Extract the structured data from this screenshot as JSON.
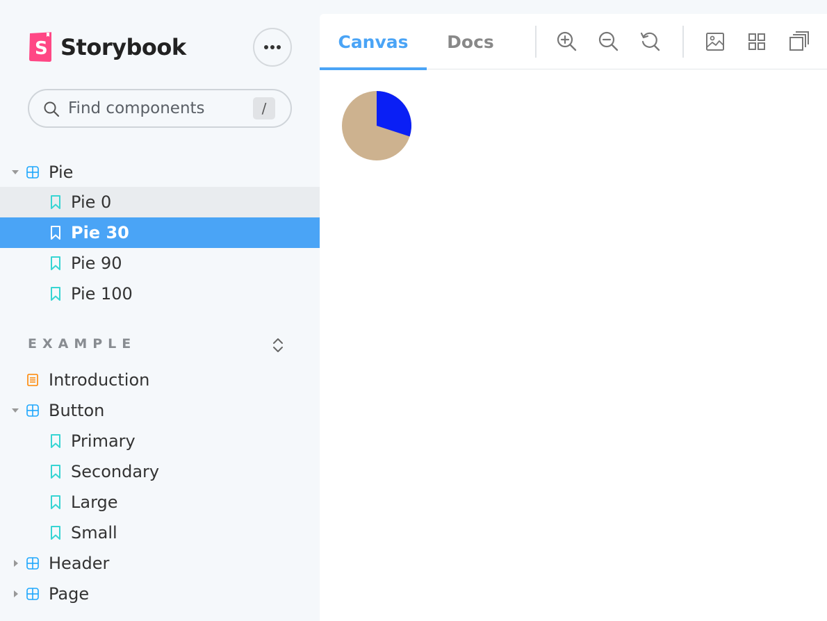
{
  "brand": {
    "name": "Storybook"
  },
  "search": {
    "placeholder": "Find components",
    "shortcut": "/"
  },
  "tree": {
    "pie": {
      "label": "Pie",
      "stories": [
        "Pie 0",
        "Pie 30",
        "Pie 90",
        "Pie 100"
      ]
    },
    "example_group": "EXAMPLE",
    "introduction": "Introduction",
    "button": {
      "label": "Button",
      "stories": [
        "Primary",
        "Secondary",
        "Large",
        "Small"
      ]
    },
    "header": "Header",
    "page": "Page"
  },
  "toolbar": {
    "tabs": [
      "Canvas",
      "Docs"
    ],
    "active_tab": "Canvas",
    "tools": [
      "zoom-in-icon",
      "zoom-out-icon",
      "zoom-reset-icon",
      "background-icon",
      "grid-icon",
      "outline-icon"
    ]
  },
  "preview": {
    "pie_percent": 30,
    "colors": {
      "filled": "#0a1ff5",
      "rest": "#cdb28f"
    }
  },
  "colors": {
    "accent": "#4aa4f6",
    "brand": "#ff4785",
    "story_icon": "#37d5d3",
    "component_icon": "#1ea7fd",
    "doc_icon": "#ff8500"
  }
}
